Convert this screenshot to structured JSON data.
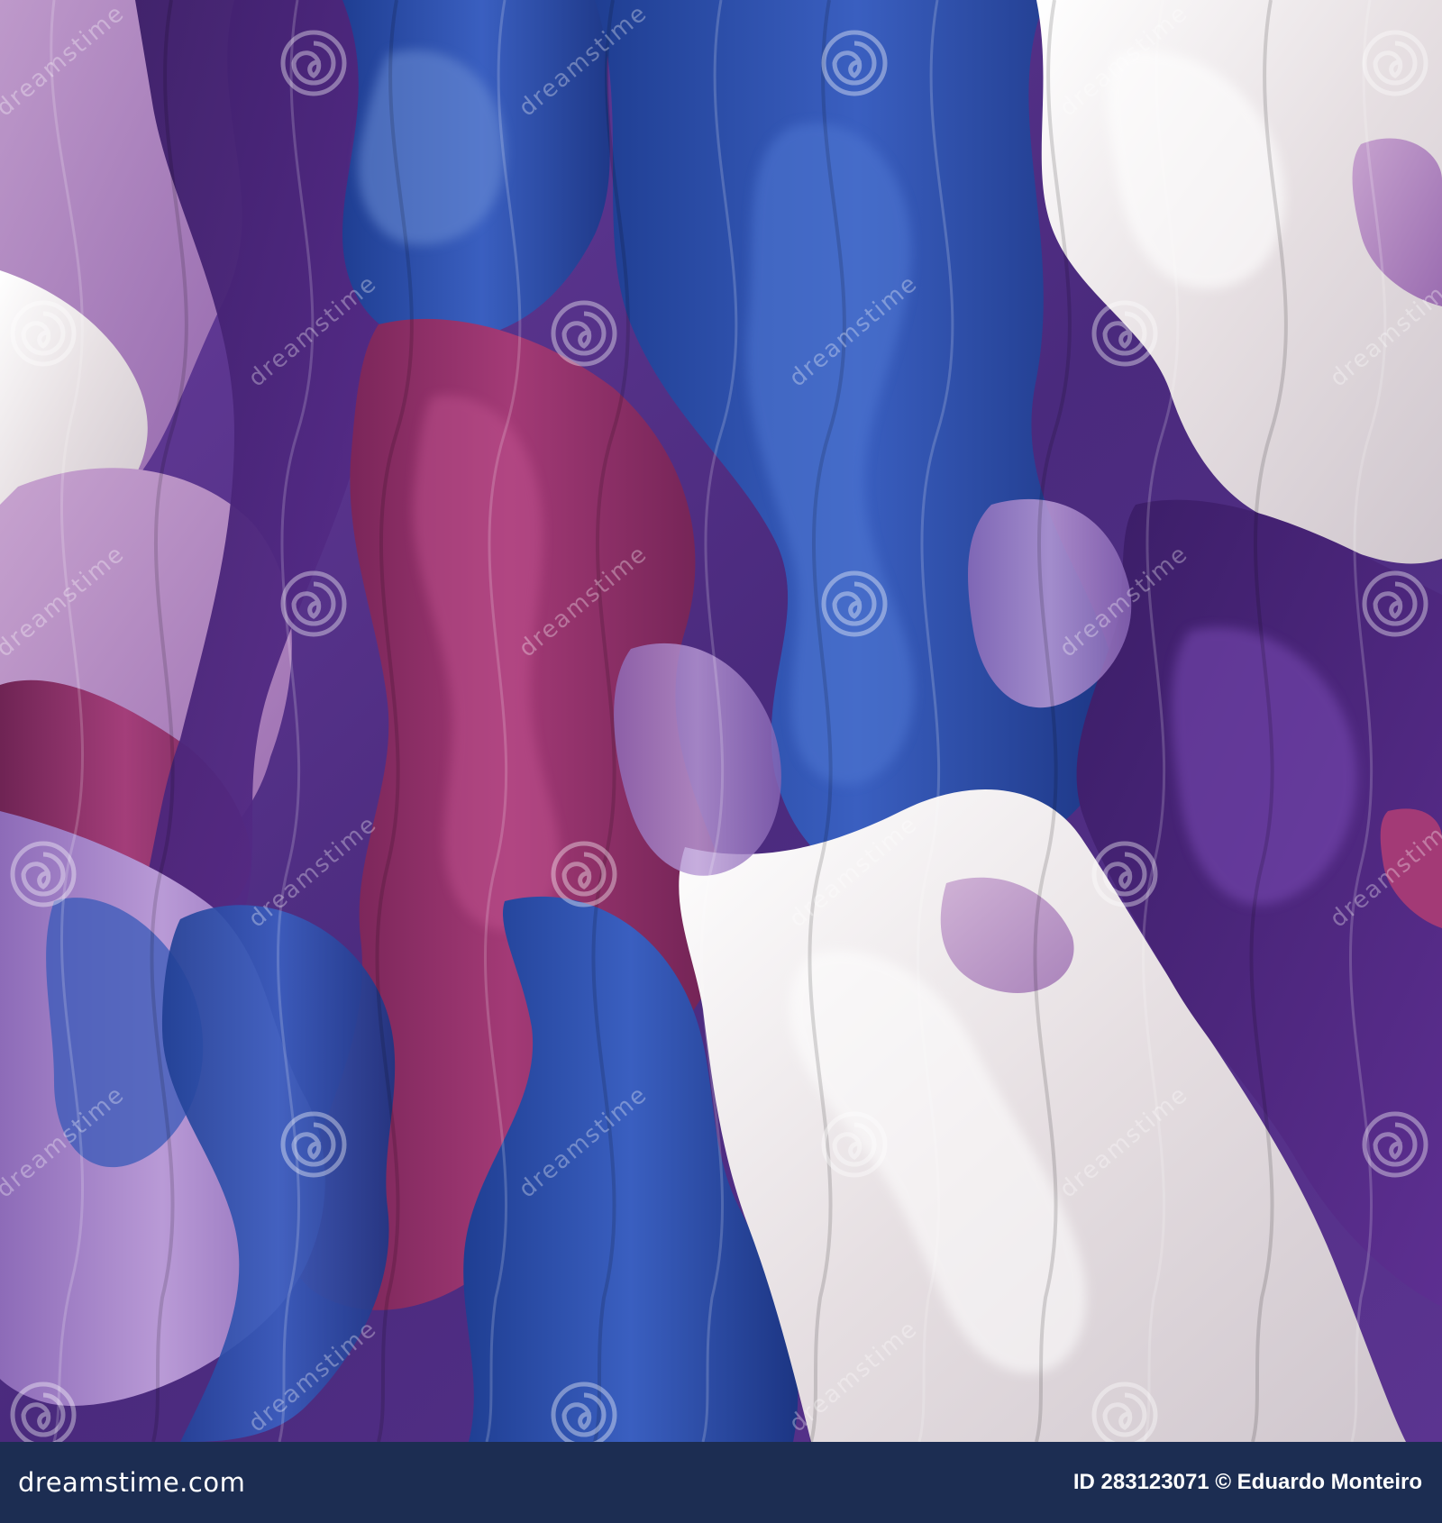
{
  "image": {
    "description_colors": {
      "white": "#efe9ea",
      "blue": "#2d4ea8",
      "purple": "#5a2f8e",
      "magenta": "#8c2c66",
      "lavender": "#9e7bc4",
      "background_bar": "#1c2d52"
    }
  },
  "watermark": {
    "text": "dreamstime"
  },
  "footer": {
    "logo_text": "dreamstime.com",
    "credit": "ID 283123071 © Eduardo Monteiro"
  }
}
